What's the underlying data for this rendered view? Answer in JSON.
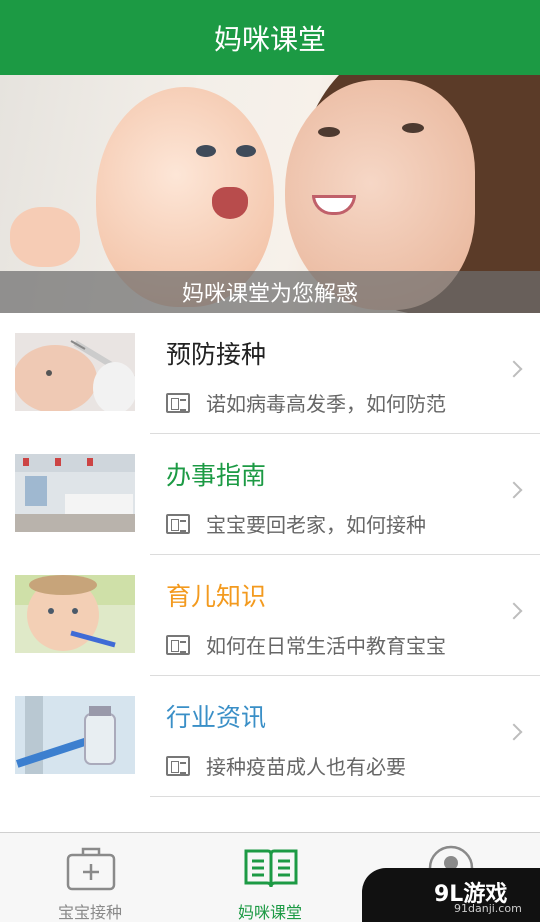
{
  "header": {
    "title": "妈咪课堂"
  },
  "banner": {
    "caption": "妈咪课堂为您解惑"
  },
  "list": {
    "items": [
      {
        "title": "预防接种",
        "title_color": "#222222",
        "subtitle": "诺如病毒高发季，如何防范"
      },
      {
        "title": "办事指南",
        "title_color": "#1c9a44",
        "subtitle": "宝宝要回老家，如何接种"
      },
      {
        "title": "育儿知识",
        "title_color": "#f39a1e",
        "subtitle": "如何在日常生活中教育宝宝"
      },
      {
        "title": "行业资讯",
        "title_color": "#3a8fc7",
        "subtitle": "接种疫苗成人也有必要"
      }
    ]
  },
  "bottom_nav": {
    "tabs": [
      {
        "label": "宝宝接种",
        "icon": "medical-kit-icon",
        "active": false
      },
      {
        "label": "妈咪课堂",
        "icon": "book-icon",
        "active": true
      },
      {
        "label": "",
        "icon": "profile-icon",
        "active": false
      }
    ],
    "active_color": "#1c9a44",
    "inactive_color": "#8a8a8a"
  },
  "watermark": {
    "brand": "9L游戏",
    "site": "91danji.com"
  }
}
